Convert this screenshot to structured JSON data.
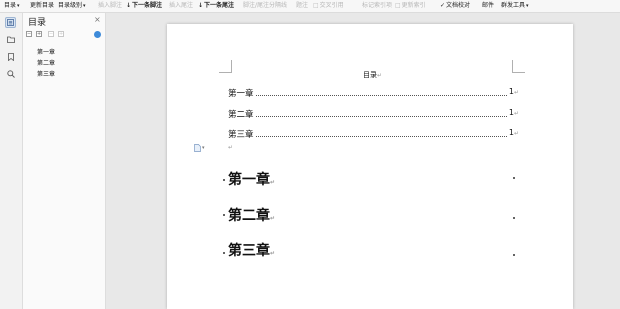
{
  "ribbon": {
    "items": [
      {
        "label": "目录",
        "has_caret": true,
        "disabled": false,
        "bold": false,
        "icon": ""
      },
      {
        "label": "更新目录",
        "has_caret": false,
        "disabled": false,
        "bold": false,
        "icon": ""
      },
      {
        "label": "目录级别",
        "has_caret": true,
        "disabled": false,
        "bold": false,
        "icon": ""
      },
      {
        "label": "插入脚注",
        "has_caret": false,
        "disabled": true,
        "bold": false,
        "icon": ""
      },
      {
        "label": "下一条脚注",
        "has_caret": false,
        "disabled": false,
        "bold": true,
        "icon": "next-footnote-icon"
      },
      {
        "label": "插入尾注",
        "has_caret": false,
        "disabled": true,
        "bold": false,
        "icon": ""
      },
      {
        "label": "下一条尾注",
        "has_caret": false,
        "disabled": false,
        "bold": true,
        "icon": "next-endnote-icon"
      },
      {
        "label": "脚注/尾注分隔线",
        "has_caret": false,
        "disabled": true,
        "bold": false,
        "icon": ""
      },
      {
        "label": "题注",
        "has_caret": false,
        "disabled": true,
        "bold": false,
        "icon": ""
      },
      {
        "label": "交叉引用",
        "has_caret": false,
        "disabled": true,
        "bold": false,
        "icon": "cross-reference-icon"
      },
      {
        "label": "标记索引项",
        "has_caret": false,
        "disabled": true,
        "bold": false,
        "icon": ""
      },
      {
        "label": "更新索引",
        "has_caret": false,
        "disabled": true,
        "bold": false,
        "icon": "update-index-icon"
      },
      {
        "label": "文档校对",
        "has_caret": false,
        "disabled": false,
        "bold": false,
        "icon": "proofread-icon"
      },
      {
        "label": "邮件",
        "has_caret": false,
        "disabled": false,
        "bold": false,
        "icon": ""
      },
      {
        "label": "群发工具",
        "has_caret": true,
        "disabled": false,
        "bold": false,
        "icon": ""
      }
    ]
  },
  "sidebar": {
    "icons": [
      "outline-icon",
      "folder-icon",
      "bookmark-icon",
      "search-icon"
    ]
  },
  "toc_panel": {
    "title": "目录",
    "close": "×",
    "controls": [
      "−",
      "+",
      "−",
      "+"
    ],
    "items": [
      "第一章",
      "第二章",
      "第三章"
    ]
  },
  "document": {
    "title": "目录",
    "para_mark": "↵",
    "toc_entries": [
      {
        "label": "第一章",
        "page": "1"
      },
      {
        "label": "第二章",
        "page": "1"
      },
      {
        "label": "第三章",
        "page": "1"
      }
    ],
    "headings": [
      "第一章",
      "第二章",
      "第三章"
    ],
    "dropdown_caret": "▾"
  }
}
